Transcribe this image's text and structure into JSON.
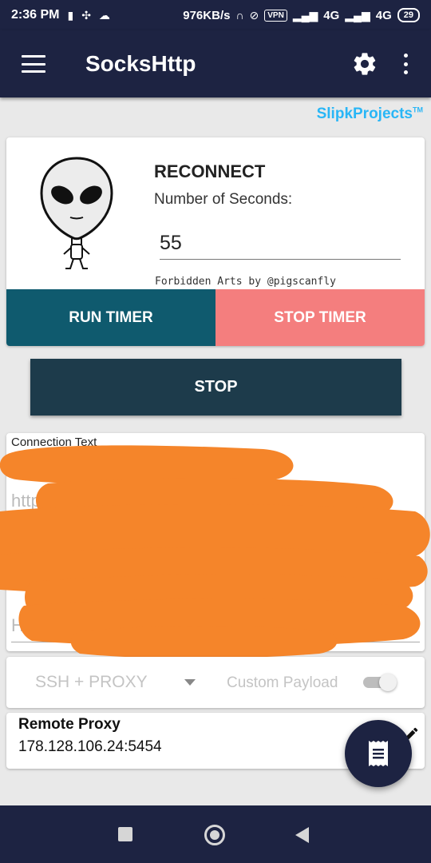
{
  "status_bar": {
    "time": "2:36 PM",
    "speed": "976KB/s",
    "vpn": "VPN",
    "network_1": "4G",
    "network_2": "4G",
    "battery": "29"
  },
  "app_bar": {
    "title": "SocksHttp",
    "menu_icon": "hamburger-menu-icon",
    "settings_icon": "gear-icon",
    "overflow_icon": "more-vertical-icon"
  },
  "brand": {
    "name": "SlipkProjects",
    "trademark": "TM",
    "color": "#29b6f6"
  },
  "timer_card": {
    "title": "RECONNECT",
    "seconds_label": "Number of Seconds:",
    "seconds_value": "55",
    "credit": "Forbidden Arts by @pigscanfly",
    "run_label": "RUN TIMER",
    "stop_label": "STOP TIMER",
    "run_color": "#0f5a6e",
    "stop_color": "#f47e7e"
  },
  "stop_button": {
    "label": "STOP",
    "color": "#1d3b4b"
  },
  "connection": {
    "label": "Connection Text",
    "lines": [
      "http",
      "Ho",
      "Ho"
    ],
    "redaction_color": "#f5852a"
  },
  "mode": {
    "selected": "SSH + PROXY",
    "payload_label": "Custom Payload",
    "payload_enabled": false
  },
  "remote_proxy": {
    "title": "Remote Proxy",
    "value": "178.128.106.24:5454",
    "edit_icon": "pencil-icon"
  },
  "fab": {
    "icon": "log-receipt-icon"
  },
  "nav_bar": {
    "items": [
      "recent-apps-icon",
      "home-icon",
      "back-icon"
    ]
  }
}
